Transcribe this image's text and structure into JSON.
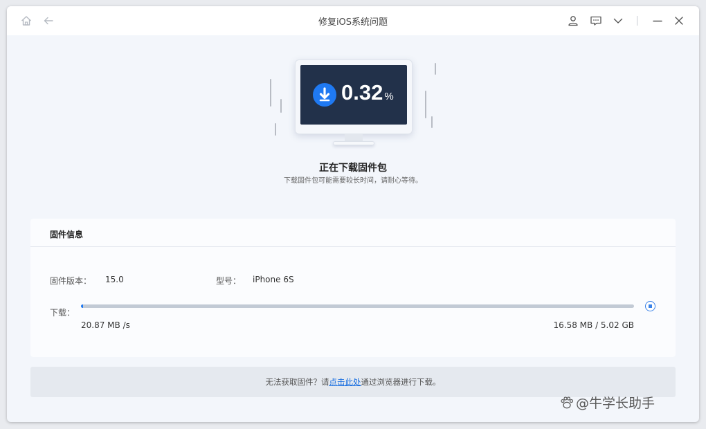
{
  "window": {
    "title": "修复iOS系统问题"
  },
  "titlebar": {
    "icons": [
      "home-icon",
      "back-arrow-icon",
      "user-icon",
      "feedback-icon",
      "chevron-down-icon",
      "minimize-icon",
      "close-icon"
    ]
  },
  "download": {
    "percent_value": "0.32",
    "percent_unit": "%",
    "progress_fraction": 0.0032,
    "title": "正在下载固件包",
    "subtitle": "下载固件包可能需要较长时间，请耐心等待。"
  },
  "firmware_info": {
    "heading": "固件信息",
    "version_label": "固件版本：",
    "version_value": "15.0",
    "model_label": "型号：",
    "model_value": "iPhone 6S",
    "download_label": "下载：",
    "speed": "20.87 MB /s",
    "size_progress": "16.58 MB / 5.02 GB"
  },
  "footer": {
    "prefix": "无法获取固件？请",
    "link": "点击此处",
    "suffix": "通过浏览器进行下载。"
  },
  "watermark": {
    "text": "@牛学长助手"
  },
  "colors": {
    "accent": "#1f79f2",
    "screen": "#22314a",
    "background": "#f3f6fb",
    "link": "#1a6fe0"
  }
}
